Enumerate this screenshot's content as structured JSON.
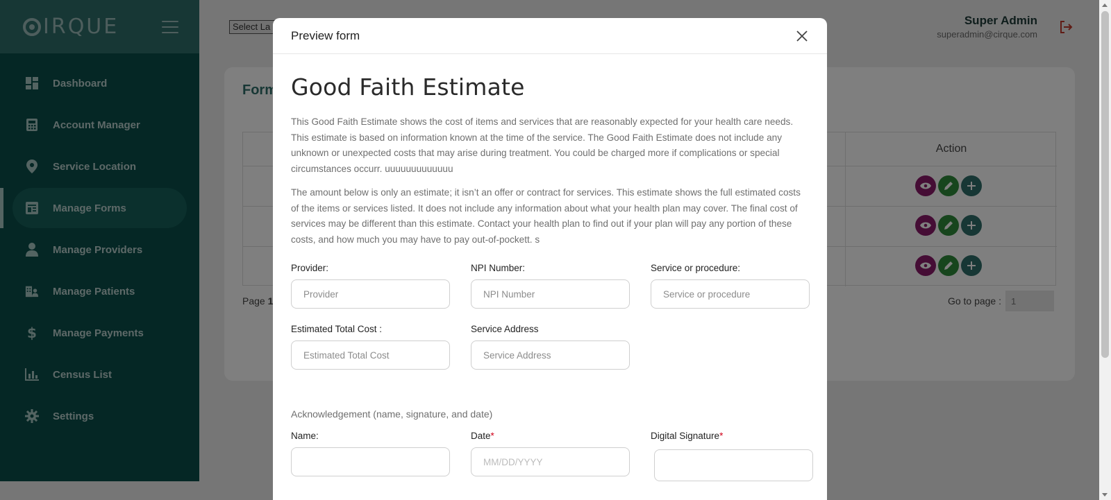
{
  "sidebar": {
    "logo": "IRQUE",
    "items": [
      {
        "label": "Dashboard",
        "icon": "dashboard-icon"
      },
      {
        "label": "Account Manager",
        "icon": "calculator-icon"
      },
      {
        "label": "Service Location",
        "icon": "location-pin-icon"
      },
      {
        "label": "Manage Forms",
        "icon": "forms-icon",
        "active": true
      },
      {
        "label": "Manage Providers",
        "icon": "user-icon"
      },
      {
        "label": "Manage Patients",
        "icon": "patients-icon"
      },
      {
        "label": "Manage Payments",
        "icon": "dollar-icon"
      },
      {
        "label": "Census List",
        "icon": "bar-chart-icon"
      },
      {
        "label": "Settings",
        "icon": "gear-icon"
      }
    ]
  },
  "header": {
    "language_select": "Select La",
    "user_name": "Super Admin",
    "user_email": "superadmin@cirque.com"
  },
  "main": {
    "title": "Form",
    "table": {
      "action_header": "Action",
      "rows": 3
    },
    "page_info_prefix": "Page ",
    "page_info_current": "1",
    "goto_label": "Go to page :",
    "goto_value": "1"
  },
  "modal": {
    "title": "Preview form",
    "heading": "Good Faith Estimate",
    "paragraph1": "This Good Faith Estimate shows the cost of items and services that are reasonably expected for your health care needs. This estimate is based on information known at the time of the service. The Good Faith Estimate does not include any unknown or unexpected costs that may arise during treatment. You could be charged more if complications or special circumstances occurr. uuuuuuuuuuuuu",
    "paragraph2": "The amount below is only an estimate; it isn’t an offer or contract for services. This estimate shows the full estimated costs of the items or services listed. It does not include any information about what your health plan may cover. The final cost of services may be different than this estimate. Contact your health plan to find out if your plan will pay any portion of these costs, and how much you may have to pay out-of-pockett. s",
    "fields": {
      "provider_label": "Provider:",
      "provider_placeholder": "Provider",
      "npi_label": "NPI Number:",
      "npi_placeholder": "NPI Number",
      "service_label": "Service or procedure:",
      "service_placeholder": "Service or procedure",
      "cost_label": "Estimated Total Cost :",
      "cost_placeholder": "Estimated Total Cost",
      "address_label": "Service Address",
      "address_placeholder": "Service Address"
    },
    "acknowledgement": "Acknowledgement (name, signature, and date)",
    "ack_fields": {
      "name_label": "Name:",
      "date_label": "Date",
      "date_placeholder": "MM/DD/YYYY",
      "signature_label": "Digital Signature",
      "required_mark": "*"
    }
  },
  "colors": {
    "sidebar_bg": "#0a4f4a",
    "brand_bg": "#2f6f6b",
    "view_btn": "#8b1a6a",
    "edit_btn": "#2f8a3a",
    "add_btn": "#2f6f6b",
    "required": "#d0021b"
  }
}
